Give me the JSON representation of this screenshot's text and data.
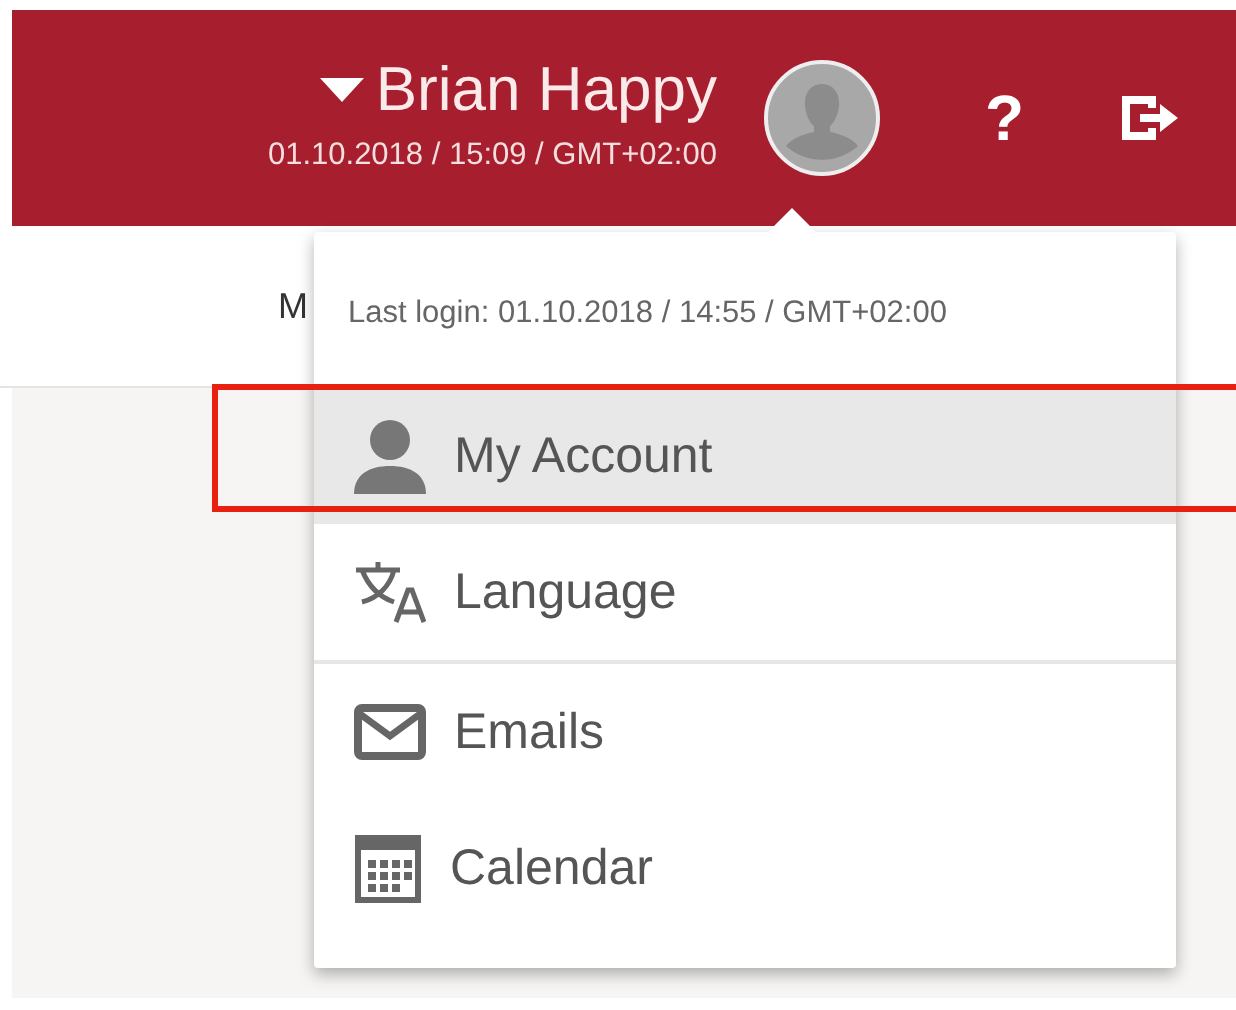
{
  "header": {
    "user_name": "Brian Happy",
    "datetime": "01.10.2018 / 15:09 / GMT+02:00",
    "help": "?"
  },
  "tab_fragment": "M",
  "user_menu": {
    "last_login": "Last login: 01.10.2018 / 14:55 / GMT+02:00",
    "items": [
      {
        "kind": "account",
        "label": "My Account",
        "selected": true,
        "framed": true,
        "divider_after": false
      },
      {
        "kind": "language",
        "label": "Language",
        "selected": false,
        "framed": false,
        "divider_after": true
      },
      {
        "kind": "emails",
        "label": "Emails",
        "selected": false,
        "framed": false,
        "divider_after": false
      },
      {
        "kind": "calendar",
        "label": "Calendar",
        "selected": false,
        "framed": false,
        "divider_after": false
      }
    ]
  }
}
